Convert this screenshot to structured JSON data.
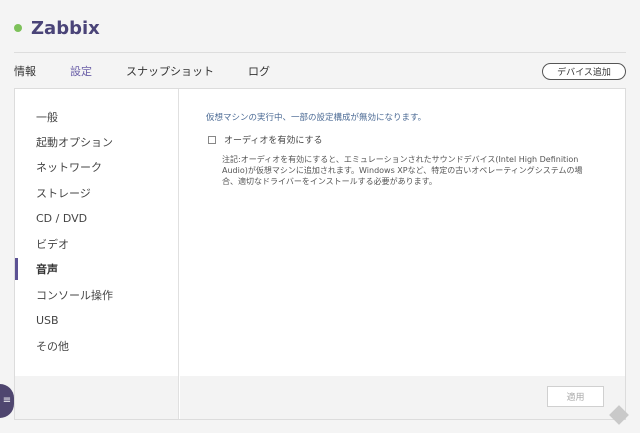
{
  "vm": {
    "name": "Zabbix",
    "status_color": "#7dc15a"
  },
  "tabs": [
    {
      "label": "情報",
      "active": false
    },
    {
      "label": "設定",
      "active": true
    },
    {
      "label": "スナップショット",
      "active": false
    },
    {
      "label": "ログ",
      "active": false
    }
  ],
  "toolbar": {
    "add_device_label": "デバイス追加"
  },
  "sidebar": {
    "items": [
      {
        "label": "一般",
        "active": false
      },
      {
        "label": "起動オプション",
        "active": false
      },
      {
        "label": "ネットワーク",
        "active": false
      },
      {
        "label": "ストレージ",
        "active": false
      },
      {
        "label": "CD / DVD",
        "active": false
      },
      {
        "label": "ビデオ",
        "active": false
      },
      {
        "label": "音声",
        "active": true
      },
      {
        "label": "コンソール操作",
        "active": false
      },
      {
        "label": "USB",
        "active": false
      },
      {
        "label": "その他",
        "active": false
      }
    ]
  },
  "audio": {
    "warning": "仮想マシンの実行中、一部の設定構成が無効になります。",
    "enable_label": "オーディオを有効にする",
    "enable_checked": false,
    "note": "注記:オーディオを有効にすると、エミュレーションされたサウンドデバイス(Intel High Definition Audio)が仮想マシンに追加されます。Windows XPなど、特定の古いオペレーティングシステムの場合、適切なドライバーをインストールする必要があります。"
  },
  "footer": {
    "apply_label": "適用",
    "apply_enabled": false
  },
  "colors": {
    "accent": "#5c5294",
    "active_tab": "#6a5fa8",
    "warning_text": "#4c6b95"
  },
  "icons": {
    "menu": "hamburger-menu-icon",
    "help": "help-diamond-icon"
  }
}
